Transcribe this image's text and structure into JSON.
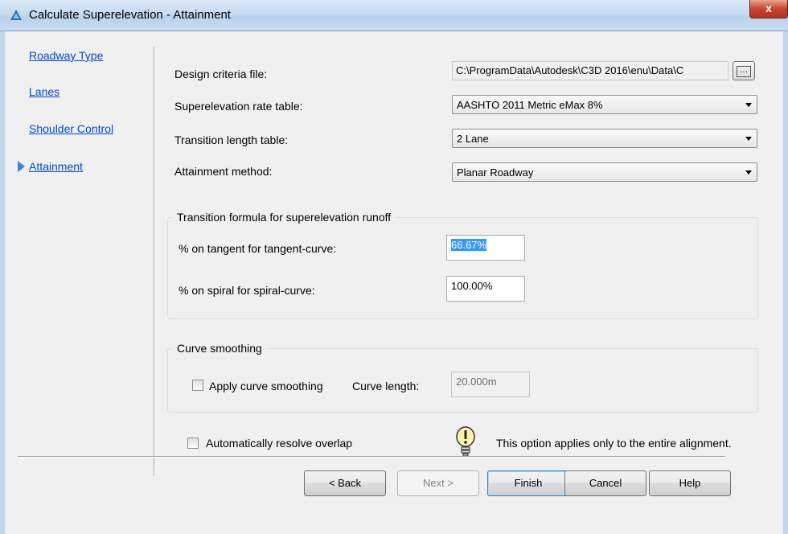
{
  "window": {
    "title": "Calculate Superelevation - Attainment",
    "close_label": "x"
  },
  "nav": {
    "items": [
      {
        "label": "Roadway Type"
      },
      {
        "label": "Lanes"
      },
      {
        "label": "Shoulder Control"
      },
      {
        "label": "Attainment"
      }
    ],
    "current": "Attainment"
  },
  "form": {
    "design_criteria_label": "Design criteria file:",
    "design_criteria_value": "C:\\ProgramData\\Autodesk\\C3D 2016\\enu\\Data\\C",
    "browse_label": "…",
    "rate_table_label": "Superelevation rate table:",
    "rate_table_value": "AASHTO 2011 Metric eMax 8%",
    "transition_table_label": "Transition length table:",
    "transition_table_value": "2 Lane",
    "attainment_method_label": "Attainment method:",
    "attainment_method_value": "Planar Roadway"
  },
  "transition_group": {
    "title": "Transition formula for superelevation runoff",
    "tangent_label": "% on tangent for tangent-curve:",
    "tangent_value": "66.67%",
    "spiral_label": "% on spiral for spiral-curve:",
    "spiral_value": "100.00%"
  },
  "smoothing_group": {
    "title": "Curve smoothing",
    "apply_label": "Apply curve smoothing",
    "apply_checked": false,
    "curve_length_label": "Curve length:",
    "curve_length_value": "20.000m"
  },
  "overlap": {
    "label": "Automatically resolve overlap",
    "checked": false,
    "info_text": "This option applies only to the entire alignment."
  },
  "buttons": {
    "back": "< Back",
    "next": "Next >",
    "finish": "Finish",
    "cancel": "Cancel",
    "help": "Help"
  }
}
